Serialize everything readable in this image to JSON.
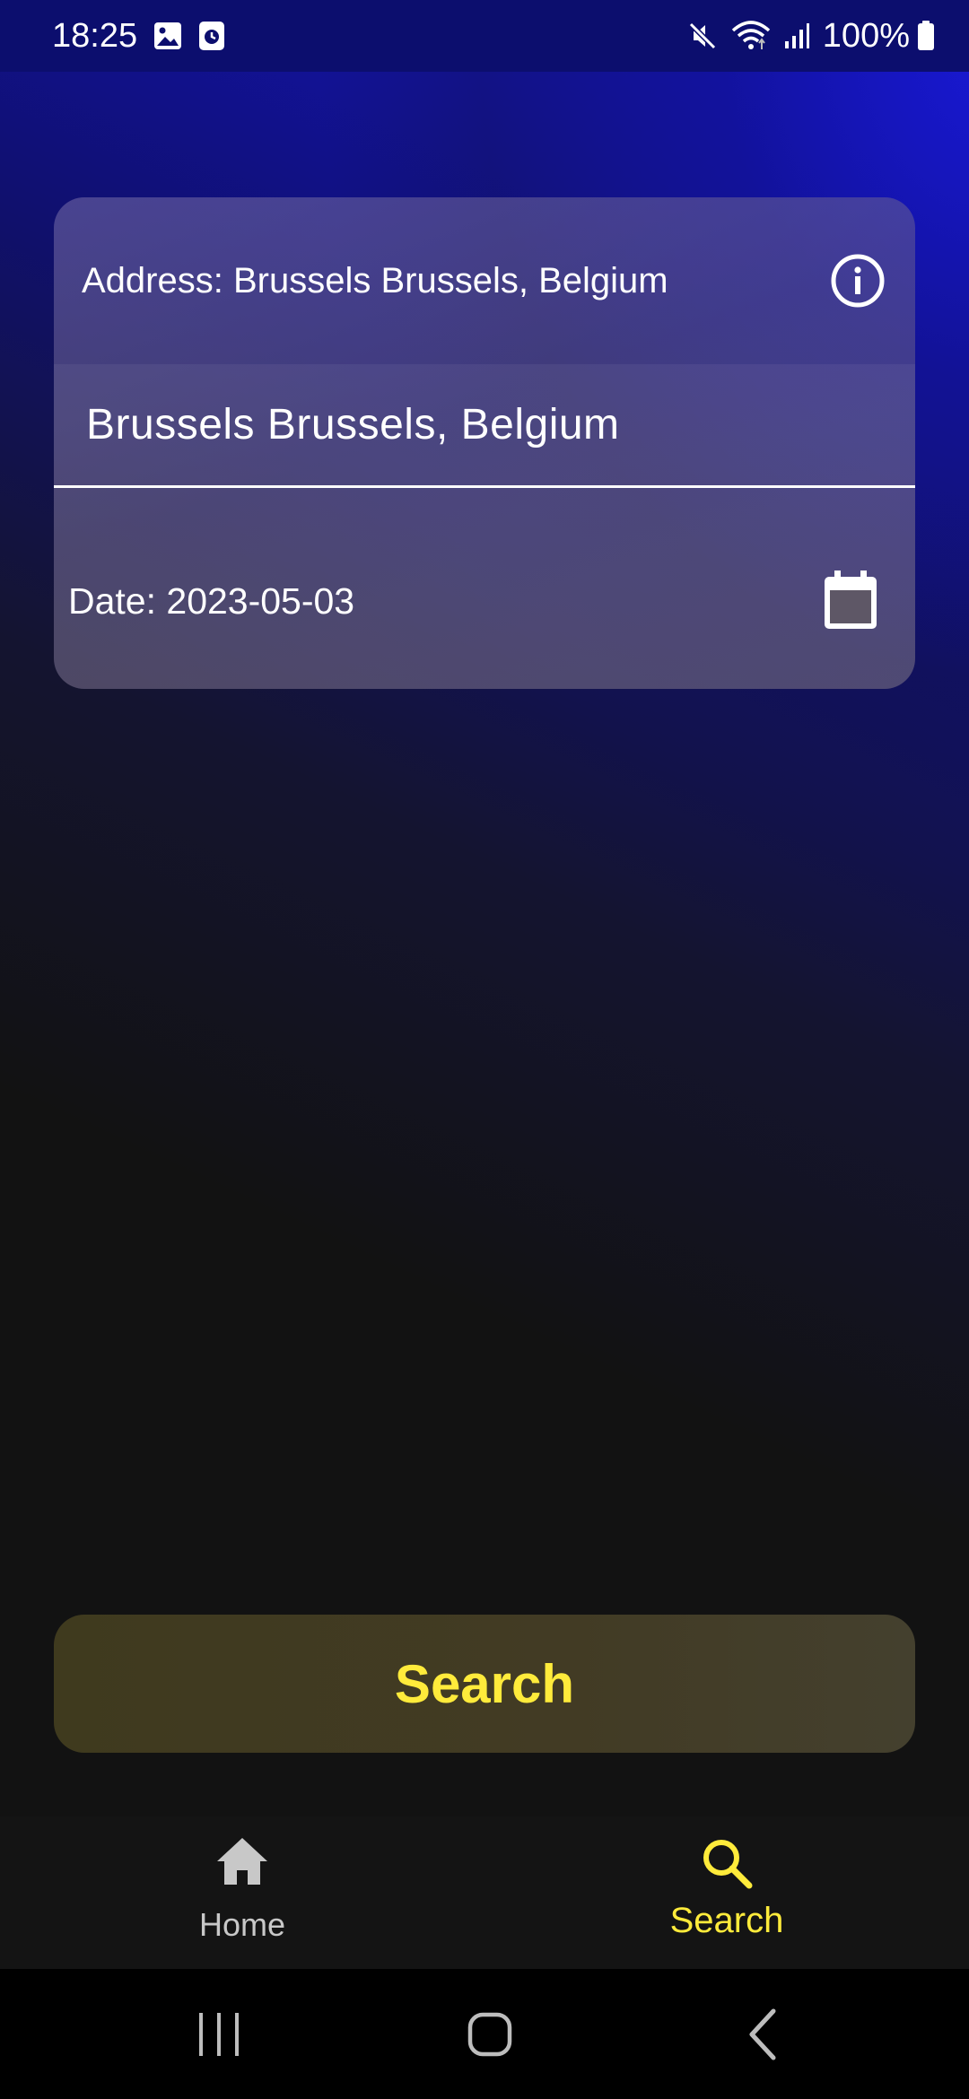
{
  "status_bar": {
    "time": "18:25",
    "battery": "100%",
    "left_icons": [
      "gallery-icon",
      "screen-recorder-icon"
    ],
    "right_icons": [
      "mute-icon",
      "wifi-icon",
      "signal-icon",
      "battery-icon"
    ]
  },
  "form": {
    "address_label": "Address: Brussels Brussels, Belgium",
    "address_value": "Brussels Brussels, Belgium",
    "date_label": "Date: 2023-05-03",
    "info_icon": "info-icon",
    "calendar_icon": "calendar-icon"
  },
  "search_button": {
    "label": "Search"
  },
  "bottom_nav": {
    "items": [
      {
        "label": "Home",
        "icon": "home-icon",
        "active": false
      },
      {
        "label": "Search",
        "icon": "search-icon",
        "active": true
      }
    ]
  },
  "system_nav": {
    "buttons": [
      "recent-apps-icon",
      "home-circle-icon",
      "back-icon"
    ]
  },
  "colors": {
    "accent": "#ffeb3b",
    "status_bar_bg": "#0c0e6e",
    "gradient_blue": "#1414c8",
    "background_dark": "#121212"
  }
}
